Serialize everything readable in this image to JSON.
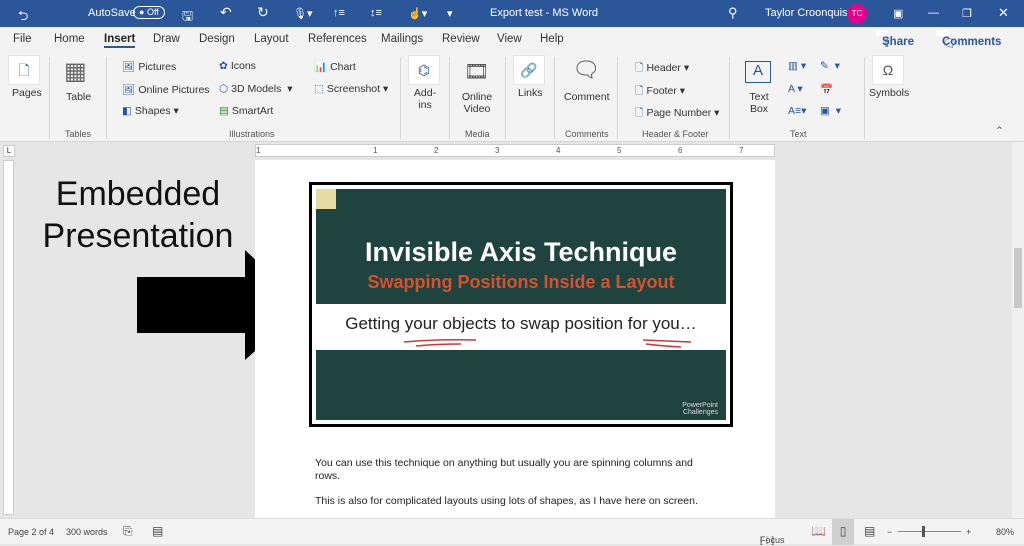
{
  "titlebar": {
    "autosave_label": "AutoSave",
    "autosave_state": "Off",
    "doc_title": "Export test - MS Word",
    "user_name": "Taylor Croonquist",
    "user_initials": "TC",
    "accent": "#2b579a",
    "avatar_color": "#e3008c"
  },
  "tabs": [
    "File",
    "Home",
    "Insert",
    "Draw",
    "Design",
    "Layout",
    "References",
    "Mailings",
    "Review",
    "View",
    "Help"
  ],
  "active_tab": "Insert",
  "share_label": "Share",
  "comments_label": "Comments",
  "ribbon": {
    "pages": "Pages",
    "table": "Table",
    "tables_group": "Tables",
    "pictures": "Pictures",
    "online_pictures": "Online Pictures",
    "shapes": "Shapes",
    "icons": "Icons",
    "models": "3D Models",
    "smartart": "SmartArt",
    "chart": "Chart",
    "screenshot": "Screenshot",
    "illustrations_group": "Illustrations",
    "addins": "Add-ins",
    "online_video": "Online Video",
    "media_group": "Media",
    "links": "Links",
    "comment": "Comment",
    "comments_group": "Comments",
    "header": "Header",
    "footer": "Footer",
    "page_number": "Page Number",
    "hf_group": "Header & Footer",
    "text_box": "Text Box",
    "text_group": "Text",
    "symbols": "Symbols"
  },
  "annotation": {
    "line1": "Embedded",
    "line2": "Presentation"
  },
  "slide": {
    "title": "Invisible Axis Technique",
    "subtitle": "Swapping Positions Inside a Layout",
    "band_text": "Getting your objects to swap position for you…",
    "logo_text": "PowerPoint Challenges",
    "bg": "#1f433f",
    "subtitle_color": "#d8502c"
  },
  "body": {
    "p1": "You can use this technique on anything but usually you are spinning columns and rows.",
    "p2": "This is also for complicated layouts using lots of shapes, as I have here on screen."
  },
  "ruler_marks": [
    "1",
    "1",
    "2",
    "3",
    "4",
    "5",
    "6",
    "7"
  ],
  "status": {
    "page": "Page 2 of 4",
    "words": "300 words",
    "focus": "Focus",
    "zoom": "80%",
    "zoom_level_percent": 80
  }
}
